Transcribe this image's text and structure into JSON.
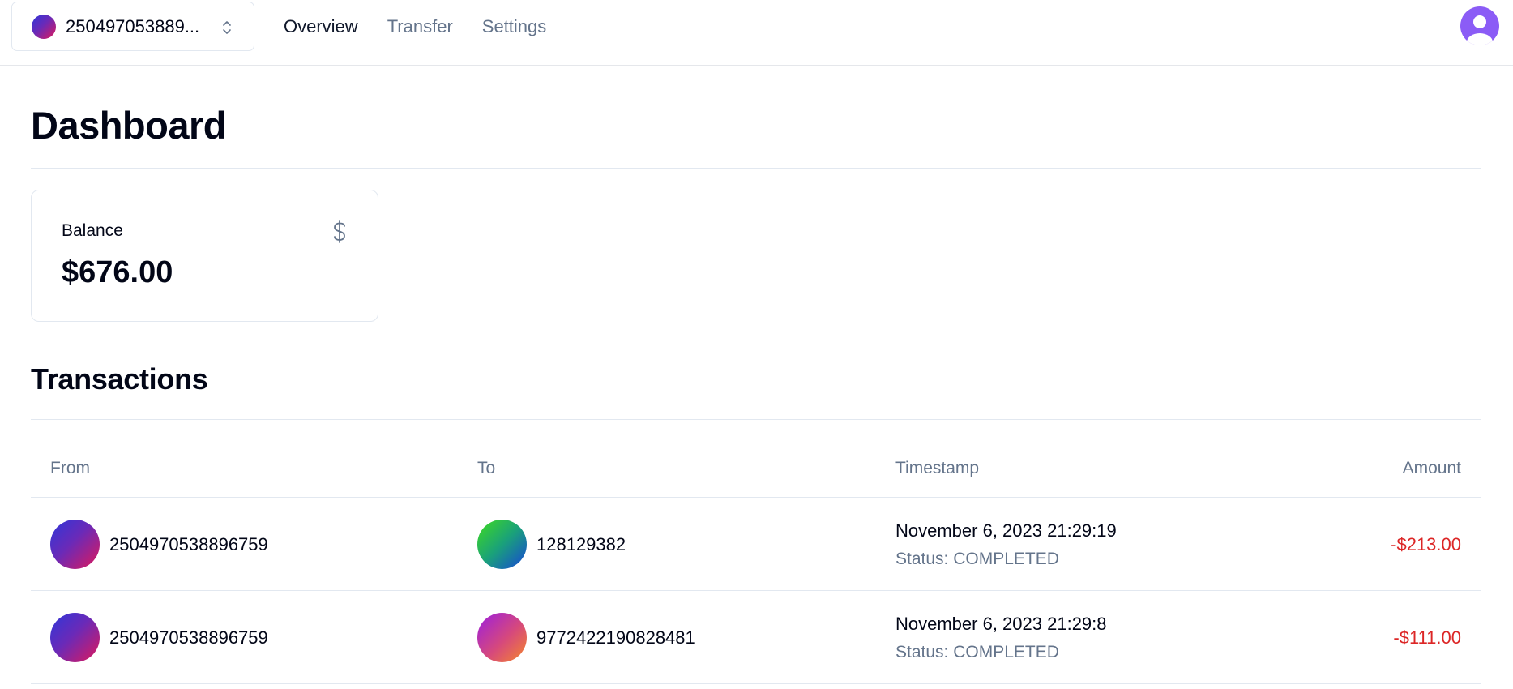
{
  "header": {
    "account_label": "250497053889...",
    "nav": [
      {
        "label": "Overview",
        "active": true
      },
      {
        "label": "Transfer",
        "active": false
      },
      {
        "label": "Settings",
        "active": false
      }
    ]
  },
  "page": {
    "title": "Dashboard"
  },
  "balance": {
    "label": "Balance",
    "value": "$676.00",
    "icon": "dollar-icon"
  },
  "transactions": {
    "title": "Transactions",
    "columns": [
      "From",
      "To",
      "Timestamp",
      "Amount"
    ],
    "rows": [
      {
        "from": "2504970538896759",
        "to": "128129382",
        "timestamp": "November 6, 2023 21:29:19",
        "status": "Status: COMPLETED",
        "amount": "-$213.00"
      },
      {
        "from": "2504970538896759",
        "to": "9772422190828481",
        "timestamp": "November 6, 2023 21:29:8",
        "status": "Status: COMPLETED",
        "amount": "-$111.00"
      }
    ]
  },
  "colors": {
    "negative_amount": "#dc2626",
    "muted_text": "#64748b",
    "user_avatar": "#8b5cf6"
  }
}
